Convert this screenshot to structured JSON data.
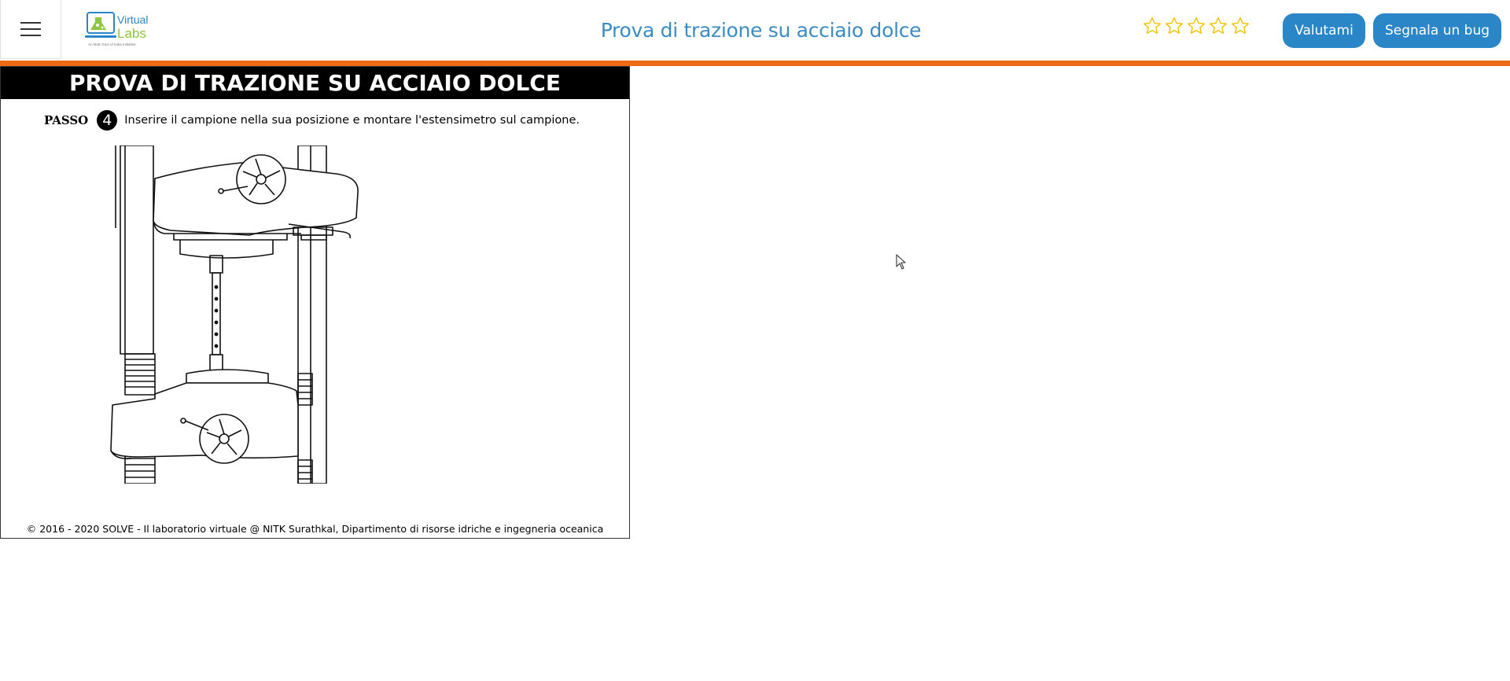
{
  "header": {
    "title": "Prova di trazione su acciaio dolce",
    "logo": {
      "line1": "Virtual",
      "line2": "Labs",
      "tagline": "An MoE Govt of India Initiative"
    },
    "rating_stars": 5,
    "rate_button": "Valutami",
    "bug_button": "Segnala un bug",
    "icons": {
      "menu": "hamburger-menu-icon",
      "star": "star-outline-icon"
    }
  },
  "colors": {
    "accent": "#ec6b14",
    "primary": "#2a86c6",
    "title": "#3c8cc3",
    "star": "#f2c200"
  },
  "simulation": {
    "heading": "PROVA DI TRAZIONE SU ACCIAIO DOLCE",
    "step_label": "PASSO",
    "step_number": "4",
    "step_text": "Inserire il campione nella sua posizione e montare l'estensimetro sul campione.",
    "footer": "© 2016 - 2020 SOLVE - Il laboratorio virtuale @ NITK Surathkal, Dipartimento di risorse idriche e ingegneria oceanica"
  }
}
